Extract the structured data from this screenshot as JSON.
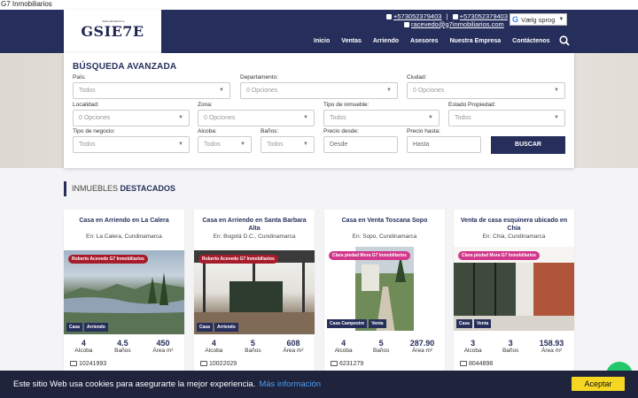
{
  "doc_title": "G7 Inmobiliarios",
  "header": {
    "logo_text": "GSIE7E",
    "logo_sub": "Inmobiliarios",
    "phone1": "+573052379403",
    "phone2": "+573052379403",
    "email": "racevedo@g7inmobiliarios.com",
    "language": "Vælg sprog",
    "nav": [
      "Inicio",
      "Ventas",
      "Arriendo",
      "Asesores",
      "Nuestra Empresa",
      "Contáctenos"
    ]
  },
  "search": {
    "title": "BÚSQUEDA AVANZADA",
    "fields": [
      {
        "label": "País:",
        "value": "Todos"
      },
      {
        "label": "Departamento:",
        "value": "0 Opciones"
      },
      {
        "label": "Ciudad:",
        "value": "0 Opciones"
      },
      {
        "label": "Localidad:",
        "value": "0 Opciones"
      },
      {
        "label": "Zona:",
        "value": "0 Opciones"
      },
      {
        "label": "Tipo de inmueble:",
        "value": "Todos"
      },
      {
        "label": "Estado Propiedad:",
        "value": "Todos"
      },
      {
        "label": "Tipo de negocio:",
        "value": "Todos"
      },
      {
        "label": "Alcoba:",
        "value": "Todos"
      },
      {
        "label": "Baños:",
        "value": "Todos"
      },
      {
        "label": "Precio desde:",
        "value": "Desde"
      },
      {
        "label": "Precio hasta:",
        "value": "Hasta"
      }
    ],
    "button": "BUSCAR"
  },
  "section": {
    "prefix": "INMUEBLES",
    "bold": "DESTACADOS"
  },
  "cards": [
    {
      "title": "Casa en Arriendo en La Calera",
      "location": "En: La Calera, Cundinamarca",
      "agent": "Roberto Acevedo G7 Inmobiliarios",
      "tags": [
        "Casa",
        "Arriendo"
      ],
      "alcoba": "4",
      "banos": "4.5",
      "area": "450",
      "id": "10241993"
    },
    {
      "title": "Casa en Arriendo en Santa Barbara Alta",
      "location": "En: Bogotá D.C., Cundinamarca",
      "agent": "Roberto Acevedo G7 Inmobiliarios",
      "tags": [
        "Casa",
        "Arriendo"
      ],
      "alcoba": "4",
      "banos": "5",
      "area": "608",
      "id": "10022029"
    },
    {
      "title": "Casa en Venta Toscana Sopo",
      "location": "En: Sopo, Cundinamarca",
      "agent": "Clara piedad Mora G7 Inmobiliarios",
      "tags": [
        "Casa Campestre",
        "Venta"
      ],
      "alcoba": "4",
      "banos": "5",
      "area": "287.90",
      "id": "6231279"
    },
    {
      "title": "Venta de casa esquinera ubicado en Chia",
      "location": "En: Chia, Cundinamarca",
      "agent": "Clara piedad Mora G7 Inmobiliarios",
      "tags": [
        "Casa",
        "Venta"
      ],
      "alcoba": "3",
      "banos": "3",
      "area": "158.93",
      "id": "8044898"
    }
  ],
  "stat_labels": {
    "alcoba": "Alcoba",
    "banos": "Baños",
    "area": "Área m²"
  },
  "cookie": {
    "text": "Este sitio Web usa cookies para asegurarte la mejor experiencia.",
    "link": "Más información",
    "accept": "Aceptar"
  },
  "colors": {
    "brand": "#262f5b",
    "badge_red": "#a71b2b",
    "badge_pink": "#d3378c",
    "cookie_bg": "#1f233c",
    "accept": "#f5d623"
  }
}
